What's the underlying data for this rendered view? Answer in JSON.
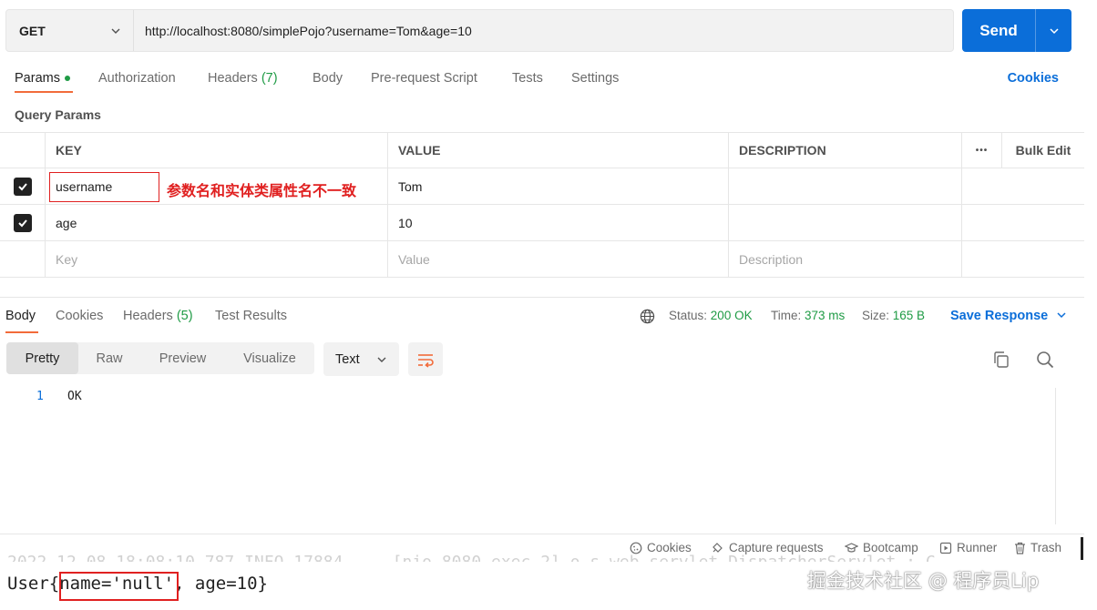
{
  "request": {
    "method": "GET",
    "url": "http://localhost:8080/simplePojo?username=Tom&age=10",
    "send_label": "Send"
  },
  "request_tabs": [
    {
      "label": "Params",
      "active": true,
      "dot": true
    },
    {
      "label": "Authorization"
    },
    {
      "label": "Headers",
      "count": "(7)"
    },
    {
      "label": "Body"
    },
    {
      "label": "Pre-request Script"
    },
    {
      "label": "Tests"
    },
    {
      "label": "Settings"
    }
  ],
  "cookies_link": "Cookies",
  "query_params": {
    "title": "Query Params",
    "headers": {
      "key": "KEY",
      "value": "VALUE",
      "description": "DESCRIPTION",
      "more": "•••",
      "bulk_edit": "Bulk Edit"
    },
    "rows": [
      {
        "checked": true,
        "key": "username",
        "value": "Tom",
        "description": ""
      },
      {
        "checked": true,
        "key": "age",
        "value": "10",
        "description": ""
      }
    ],
    "placeholders": {
      "key": "Key",
      "value": "Value",
      "description": "Description"
    },
    "annotation": "参数名和实体类属性名不一致"
  },
  "response": {
    "tabs": [
      {
        "label": "Body",
        "active": true
      },
      {
        "label": "Cookies"
      },
      {
        "label": "Headers",
        "count": "(5)"
      },
      {
        "label": "Test Results"
      }
    ],
    "status_label": "Status:",
    "status_value": "200 OK",
    "time_label": "Time:",
    "time_value": "373 ms",
    "size_label": "Size:",
    "size_value": "165 B",
    "save_label": "Save Response",
    "view_modes": [
      "Pretty",
      "Raw",
      "Preview",
      "Visualize"
    ],
    "active_view": "Pretty",
    "format": "Text",
    "body_lines": [
      {
        "num": "1",
        "text": "OK"
      }
    ]
  },
  "statusbar": {
    "items": [
      "Cookies",
      "Capture requests",
      "Bootcamp",
      "Runner",
      "Trash"
    ]
  },
  "console": {
    "ghost_line": "2022-12-08 18:08:10.787  INFO 17884 --- [nio-8080-exec-2] o.s.web.servlet.DispatcherServlet  : C",
    "prefix": "User{",
    "highlighted": "name='null'",
    "suffix": ", age=10}"
  },
  "watermark": "掘金技术社区 @ 程序员Lip",
  "colors": {
    "accent_blue": "#0b6ed9",
    "active_orange": "#f26b3a",
    "success_green": "#1f9b45",
    "annotation_red": "#e02020"
  }
}
